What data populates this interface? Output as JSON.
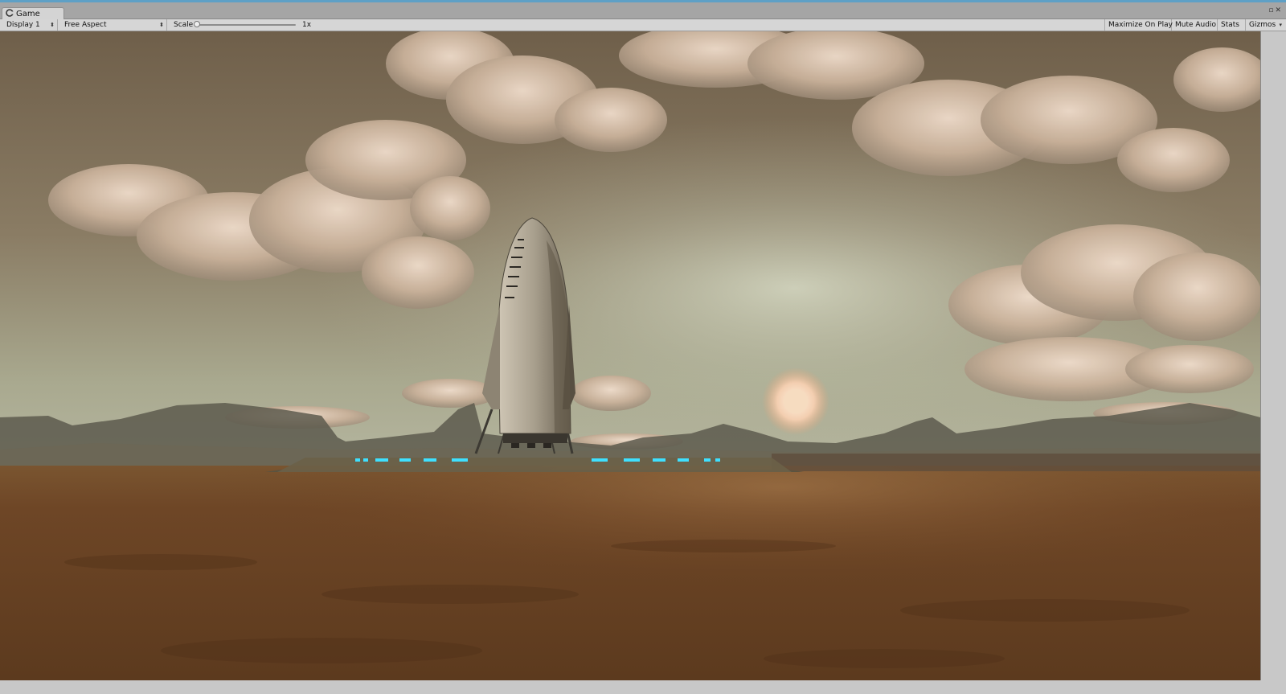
{
  "tab": {
    "title": "Game",
    "icon": "gamepad-icon"
  },
  "window_controls": {
    "menu_icon": "window-menu-icon",
    "close_icon": "close-icon"
  },
  "toolbar": {
    "display": "Display 1",
    "aspect": "Free Aspect",
    "scale_label": "Scale",
    "scale_value": "1x",
    "scale_level": 0,
    "maximize_on_play": "Maximize On Play",
    "mute_audio": "Mute Audio",
    "stats": "Stats",
    "gizmos": "Gizmos"
  },
  "scene": {
    "description_icon": "game-view",
    "colors": {
      "sky_top": "#6f5f4a",
      "sky_horizon": "#b4b7a0",
      "sun": "#f3d8b8",
      "ground": "#6a4222",
      "pad_lights": "#3fe0ff"
    }
  }
}
